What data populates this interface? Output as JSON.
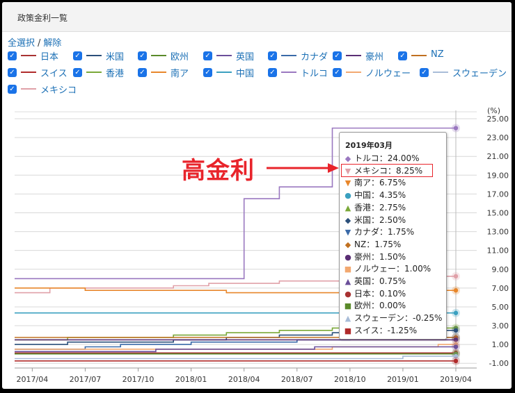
{
  "header": {
    "title": "政策金利一覧"
  },
  "select": {
    "all": "全選択",
    "sep": "/",
    "none": "解除"
  },
  "legend": [
    {
      "name": "日本",
      "color": "#a83232"
    },
    {
      "name": "米国",
      "color": "#2b4f7a"
    },
    {
      "name": "欧州",
      "color": "#5a8a2a"
    },
    {
      "name": "英国",
      "color": "#6a4f9a"
    },
    {
      "name": "カナダ",
      "color": "#3a6aa8"
    },
    {
      "name": "豪州",
      "color": "#5a2e74"
    },
    {
      "name": "NZ",
      "color": "#c07020"
    },
    {
      "name": "スイス",
      "color": "#b02a2a"
    },
    {
      "name": "香港",
      "color": "#7aa838"
    },
    {
      "name": "南ア",
      "color": "#e8862a"
    },
    {
      "name": "中国",
      "color": "#3aa0c0"
    },
    {
      "name": "トルコ",
      "color": "#9a78c0"
    },
    {
      "name": "ノルウェー",
      "color": "#f2a870"
    },
    {
      "name": "スウェーデン",
      "color": "#a8bcd8"
    },
    {
      "name": "メキシコ",
      "color": "#e0a0a8"
    }
  ],
  "tooltip": {
    "title": "2019年03月",
    "rows": [
      {
        "mark": "◆",
        "color": "#9a78c0",
        "text": "トルコ：24.00%"
      },
      {
        "mark": "▼",
        "color": "#e0a0a8",
        "text": "メキシコ：8.25%"
      },
      {
        "mark": "▼",
        "color": "#e8862a",
        "text": "南ア：6.75%"
      },
      {
        "mark": "●",
        "color": "#3aa0c0",
        "text": "中国：4.35%"
      },
      {
        "mark": "▲",
        "color": "#7aa838",
        "text": "香港：2.75%"
      },
      {
        "mark": "◆",
        "color": "#2b4f7a",
        "text": "米国：2.50%"
      },
      {
        "mark": "▼",
        "color": "#3a6aa8",
        "text": "カナダ：1.75%"
      },
      {
        "mark": "◆",
        "color": "#c07020",
        "text": "NZ：1.75%"
      },
      {
        "mark": "●",
        "color": "#5a2e74",
        "text": "豪州：1.50%"
      },
      {
        "mark": "■",
        "color": "#f2a870",
        "text": "ノルウェー：1.00%"
      },
      {
        "mark": "▲",
        "color": "#6a4f9a",
        "text": "英国：0.75%"
      },
      {
        "mark": "●",
        "color": "#a83232",
        "text": "日本：0.10%"
      },
      {
        "mark": "■",
        "color": "#5a8a2a",
        "text": "欧州：0.00%"
      },
      {
        "mark": "▲",
        "color": "#a8bcd8",
        "text": "スウェーデン：-0.25%"
      },
      {
        "mark": "■",
        "color": "#b02a2a",
        "text": "スイス：-1.25%"
      }
    ]
  },
  "annotation": "高金利",
  "chart_data": {
    "type": "line",
    "ylabel": "(%)",
    "ylim": [
      -1.5,
      25.0
    ],
    "yticks": [
      "25.00",
      "23.00",
      "21.00",
      "19.00",
      "17.00",
      "15.00",
      "13.00",
      "11.00",
      "9.00",
      "7.00",
      "5.00",
      "3.00",
      "1.00",
      "-1.00"
    ],
    "ytick_values": [
      25,
      23,
      21,
      19,
      17,
      15,
      13,
      11,
      9,
      7,
      5,
      3,
      1,
      -1
    ],
    "xticks": [
      "2017/04",
      "2017/07",
      "2017/10",
      "2018/01",
      "2018/04",
      "2018/07",
      "2018/10",
      "2019/01",
      "2019/04"
    ],
    "x_range": [
      "2017/03",
      "2019/04"
    ],
    "grid": true,
    "series": [
      {
        "name": "トルコ",
        "color": "#9a78c0",
        "points": [
          [
            "2017/03",
            8.0
          ],
          [
            "2018/04",
            8.0
          ],
          [
            "2018/04",
            16.5
          ],
          [
            "2018/06",
            16.5
          ],
          [
            "2018/06",
            17.75
          ],
          [
            "2018/09",
            17.75
          ],
          [
            "2018/09",
            24.0
          ],
          [
            "2019/04",
            24.0
          ]
        ]
      },
      {
        "name": "メキシコ",
        "color": "#e0a0a8",
        "points": [
          [
            "2017/03",
            6.5
          ],
          [
            "2017/05",
            6.5
          ],
          [
            "2017/05",
            7.0
          ],
          [
            "2017/12",
            7.0
          ],
          [
            "2017/12",
            7.25
          ],
          [
            "2018/02",
            7.25
          ],
          [
            "2018/02",
            7.5
          ],
          [
            "2018/06",
            7.5
          ],
          [
            "2018/06",
            7.75
          ],
          [
            "2018/11",
            7.75
          ],
          [
            "2018/11",
            8.0
          ],
          [
            "2018/12",
            8.0
          ],
          [
            "2018/12",
            8.25
          ],
          [
            "2019/04",
            8.25
          ]
        ]
      },
      {
        "name": "南ア",
        "color": "#e8862a",
        "points": [
          [
            "2017/03",
            7.0
          ],
          [
            "2017/07",
            7.0
          ],
          [
            "2017/07",
            6.75
          ],
          [
            "2018/03",
            6.75
          ],
          [
            "2018/03",
            6.5
          ],
          [
            "2018/11",
            6.5
          ],
          [
            "2018/11",
            6.75
          ],
          [
            "2019/04",
            6.75
          ]
        ]
      },
      {
        "name": "中国",
        "color": "#3aa0c0",
        "points": [
          [
            "2017/03",
            4.35
          ],
          [
            "2019/04",
            4.35
          ]
        ]
      },
      {
        "name": "香港",
        "color": "#7aa838",
        "points": [
          [
            "2017/03",
            1.5
          ],
          [
            "2017/06",
            1.5
          ],
          [
            "2017/06",
            1.75
          ],
          [
            "2017/12",
            1.75
          ],
          [
            "2017/12",
            2.0
          ],
          [
            "2018/03",
            2.0
          ],
          [
            "2018/03",
            2.25
          ],
          [
            "2018/06",
            2.25
          ],
          [
            "2018/06",
            2.5
          ],
          [
            "2018/09",
            2.5
          ],
          [
            "2018/09",
            2.75
          ],
          [
            "2019/04",
            2.75
          ]
        ]
      },
      {
        "name": "米国",
        "color": "#2b4f7a",
        "points": [
          [
            "2017/03",
            1.0
          ],
          [
            "2017/06",
            1.0
          ],
          [
            "2017/06",
            1.25
          ],
          [
            "2017/12",
            1.25
          ],
          [
            "2017/12",
            1.5
          ],
          [
            "2018/03",
            1.5
          ],
          [
            "2018/03",
            1.75
          ],
          [
            "2018/06",
            1.75
          ],
          [
            "2018/06",
            2.0
          ],
          [
            "2018/09",
            2.0
          ],
          [
            "2018/09",
            2.25
          ],
          [
            "2018/12",
            2.25
          ],
          [
            "2018/12",
            2.5
          ],
          [
            "2019/04",
            2.5
          ]
        ]
      },
      {
        "name": "カナダ",
        "color": "#3a6aa8",
        "points": [
          [
            "2017/03",
            0.5
          ],
          [
            "2017/07",
            0.5
          ],
          [
            "2017/07",
            0.75
          ],
          [
            "2017/09",
            0.75
          ],
          [
            "2017/09",
            1.0
          ],
          [
            "2018/01",
            1.0
          ],
          [
            "2018/01",
            1.25
          ],
          [
            "2018/07",
            1.25
          ],
          [
            "2018/07",
            1.5
          ],
          [
            "2018/10",
            1.5
          ],
          [
            "2018/10",
            1.75
          ],
          [
            "2019/04",
            1.75
          ]
        ]
      },
      {
        "name": "NZ",
        "color": "#c07020",
        "points": [
          [
            "2017/03",
            1.75
          ],
          [
            "2019/04",
            1.75
          ]
        ]
      },
      {
        "name": "豪州",
        "color": "#5a2e74",
        "points": [
          [
            "2017/03",
            1.5
          ],
          [
            "2019/04",
            1.5
          ]
        ]
      },
      {
        "name": "ノルウェー",
        "color": "#f2a870",
        "points": [
          [
            "2017/03",
            0.5
          ],
          [
            "2018/09",
            0.5
          ],
          [
            "2018/09",
            0.75
          ],
          [
            "2019/03",
            0.75
          ],
          [
            "2019/03",
            1.0
          ],
          [
            "2019/04",
            1.0
          ]
        ]
      },
      {
        "name": "英国",
        "color": "#6a4f9a",
        "points": [
          [
            "2017/03",
            0.25
          ],
          [
            "2017/11",
            0.25
          ],
          [
            "2017/11",
            0.5
          ],
          [
            "2018/08",
            0.5
          ],
          [
            "2018/08",
            0.75
          ],
          [
            "2019/04",
            0.75
          ]
        ]
      },
      {
        "name": "日本",
        "color": "#a83232",
        "points": [
          [
            "2017/03",
            0.1
          ],
          [
            "2019/04",
            0.1
          ]
        ]
      },
      {
        "name": "欧州",
        "color": "#5a8a2a",
        "points": [
          [
            "2017/03",
            0.0
          ],
          [
            "2019/04",
            0.0
          ]
        ]
      },
      {
        "name": "スウェーデン",
        "color": "#a8bcd8",
        "points": [
          [
            "2017/03",
            -0.5
          ],
          [
            "2019/01",
            -0.5
          ],
          [
            "2019/01",
            -0.25
          ],
          [
            "2019/04",
            -0.25
          ]
        ]
      },
      {
        "name": "スイス",
        "color": "#b02a2a",
        "points": [
          [
            "2017/03",
            -0.75
          ],
          [
            "2019/04",
            -0.75
          ]
        ]
      }
    ],
    "highlighted_x": "2019/03"
  }
}
